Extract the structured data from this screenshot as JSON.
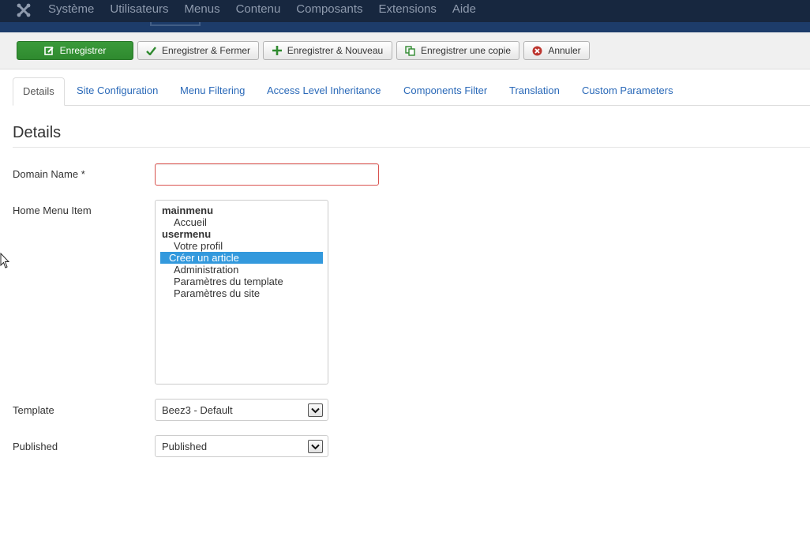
{
  "topnav": {
    "items": [
      "Système",
      "Utilisateurs",
      "Menus",
      "Contenu",
      "Composants",
      "Extensions",
      "Aide"
    ]
  },
  "toolbar": {
    "save_label": "Enregistrer",
    "save_close_label": "Enregistrer & Fermer",
    "save_new_label": "Enregistrer & Nouveau",
    "save_copy_label": "Enregistrer une copie",
    "cancel_label": "Annuler"
  },
  "tabs": [
    {
      "label": "Details",
      "active": true
    },
    {
      "label": "Site Configuration"
    },
    {
      "label": "Menu Filtering"
    },
    {
      "label": "Access Level Inheritance"
    },
    {
      "label": "Components Filter"
    },
    {
      "label": "Translation"
    },
    {
      "label": "Custom Parameters"
    }
  ],
  "section": {
    "title": "Details"
  },
  "form": {
    "domain_name": {
      "label": "Domain Name *",
      "value": ""
    },
    "home_menu_item": {
      "label": "Home Menu Item",
      "groups": [
        {
          "name": "mainmenu",
          "options": [
            "Accueil"
          ]
        },
        {
          "name": "usermenu",
          "options": [
            "Votre profil",
            "Créer un article",
            "Administration",
            "Paramètres du template",
            "Paramètres du site"
          ]
        }
      ],
      "selected": "Créer un article"
    },
    "template": {
      "label": "Template",
      "value": "Beez3 - Default"
    },
    "published": {
      "label": "Published",
      "value": "Published"
    }
  },
  "colors": {
    "navbar": "#17273f",
    "subheader": "#1d3c6a",
    "save_button": "#2f8a2f",
    "link": "#2a69b8",
    "selection": "#3399dd",
    "error_border": "#d9534f"
  }
}
